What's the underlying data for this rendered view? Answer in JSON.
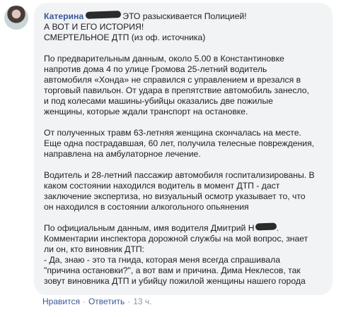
{
  "comment": {
    "author": "Катерина",
    "header_lines": [
      "ЭТО разыскивается Полицией!",
      "А ВОТ И ЕГО ИСТОРИЯ!",
      "СМЕРТЕЛЬНОЕ ДТП (из оф. источника)"
    ],
    "paragraphs": [
      [
        "По предварительным данным, около 5.00 в Константиновке",
        "напротив дома 4 по улице Громова 25-летний водитель",
        "автомобиля «Хонда» не справился с управлением и врезался в",
        "торговый павильон. От удара в препятствие автомобиль занесло,",
        "и под колесами машины-убийцы оказались две пожилые",
        "женщины, которые ждали транспорт на остановке."
      ],
      [
        "От полученных травм 63-летняя женщина скончалась на месте.",
        "Еще одна пострадавшая, 60 лет, получила телесные повреждения,",
        "направлена на амбулаторное лечение."
      ],
      [
        "Водитель и 28-летний пассажир автомобиля госпитализированы. В",
        "каком состоянии находился водитель в момент ДТП - даст",
        "заключение экспертиза, но визуальный осмотр указывает то, что",
        "он находился в состоянии алкогольного опьянения"
      ]
    ],
    "last_paragraph": {
      "first_line_prefix": "По официальным данным, имя водителя Дмитрий Н",
      "first_line_suffix": ".",
      "lines": [
        "Комментарии инспектора дорожной службы на мой вопрос, знает",
        "ли он, кто виновник ДТП:",
        "- Да, знаю - это та гнида, которая меня всегда спрашивала",
        "\"причина остановки?\", а вот вам и причина. Дима Неклесов, так",
        "зовут виновника ДТП и убийцу пожилой женщины нашего города"
      ]
    }
  },
  "actions": {
    "like": "Нравится",
    "reply": "Ответить",
    "time": "13 ч.",
    "separator": "·"
  },
  "colors": {
    "link": "#385898",
    "bubble": "#f2f3f5",
    "meta": "#90949c"
  }
}
